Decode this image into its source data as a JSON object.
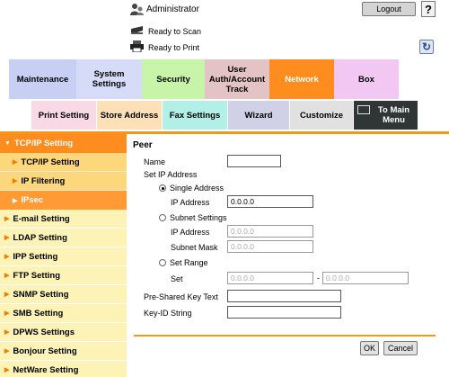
{
  "header": {
    "user": "Administrator",
    "logout": "Logout",
    "help": "?",
    "status_scan": "Ready to Scan",
    "status_print": "Ready to Print",
    "refresh_icon": "refresh-icon"
  },
  "tabs": {
    "maintenance": "Maintenance",
    "system": "System Settings",
    "security": "Security",
    "user_auth": "User Auth/Account Track",
    "network": "Network",
    "box": "Box"
  },
  "subtabs": {
    "print": "Print Setting",
    "store": "Store Address",
    "fax": "Fax Settings",
    "wizard": "Wizard",
    "customize": "Customize",
    "to_main": "To Main Menu"
  },
  "sidebar": {
    "tcpip_header": "TCP/IP Setting",
    "tcpip_sub": "TCP/IP Setting",
    "ip_filtering": "IP Filtering",
    "ipsec": "IPsec",
    "items": [
      "E-mail Setting",
      "LDAP Setting",
      "IPP Setting",
      "FTP Setting",
      "SNMP Setting",
      "SMB Setting",
      "DPWS Settings",
      "Bonjour Setting",
      "NetWare Setting"
    ]
  },
  "form": {
    "title": "Peer",
    "name_label": "Name",
    "name_value": "",
    "set_ip_label": "Set IP Address",
    "single_label": "Single Address",
    "single_ip_label": "IP Address",
    "single_ip_value": "0.0.0.0",
    "subnet_label": "Subnet Settings",
    "subnet_ip_label": "IP Address",
    "subnet_ip_value": "0.0.0.0",
    "subnet_mask_label": "Subnet Mask",
    "subnet_mask_value": "0.0.0.0",
    "range_label": "Set Range",
    "set_label": "Set",
    "range_from": "0.0.0.0",
    "range_dash": "-",
    "range_to": "0.0.0.0",
    "psk_label": "Pre-Shared Key Text",
    "psk_value": "",
    "keyid_label": "Key-ID String",
    "keyid_value": "",
    "ok": "OK",
    "cancel": "Cancel"
  },
  "colors": {
    "accent_orange": "#ff8c1f",
    "sidebar_bg": "#fdf3b7"
  }
}
